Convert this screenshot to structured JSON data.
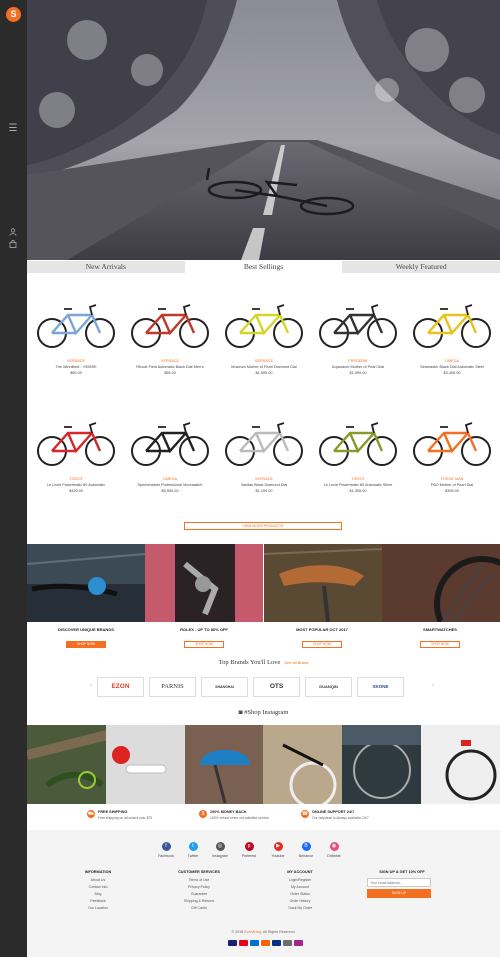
{
  "sidebar": {
    "logo": "S",
    "icons": [
      "menu-icon",
      "user-icon",
      "bag-icon"
    ]
  },
  "tabs": [
    {
      "label": "New Arrivals",
      "active": false
    },
    {
      "label": "Best Sellings",
      "active": true
    },
    {
      "label": "Weekly Featured",
      "active": false
    }
  ],
  "products": [
    {
      "brand": "VERSACE",
      "name": "The Winnifield - Y555SK",
      "price": "$95.00",
      "color": "#7aa6d8"
    },
    {
      "brand": "VERSACE",
      "name": "Rhode Field Automatic Black Dial Men's",
      "price": "$95.00",
      "color": "#c0392b"
    },
    {
      "brand": "VERSACE",
      "name": "Museum Mother of Pearl Diamond Dial",
      "price": "$1,595.00",
      "color": "#d4d62a"
    },
    {
      "brand": "FREDERIK",
      "name": "Aquaracer Mother of Pearl Dial",
      "price": "$1,399.00",
      "color": "#333333"
    },
    {
      "brand": "OMEGA",
      "name": "Seamaster Black Dial Automatic Steel",
      "price": "$3,495.00",
      "color": "#e8c31c"
    },
    {
      "brand": "TISSOT",
      "name": "Le Locle Powermatic 80 Automatic",
      "price": "$420.00",
      "color": "#d62828"
    },
    {
      "brand": "OMEGA",
      "name": "Speedmaster Professional Moonwatch",
      "price": "$5,550.00",
      "color": "#222222"
    },
    {
      "brand": "VERSACE",
      "name": "Vanitas Black Diamond Dial",
      "price": "$1,199.00",
      "color": "#bbbbbb"
    },
    {
      "brand": "TISSOT",
      "name": "Le Locle Powermatic 80 Automatic Silver",
      "price": "$1,395.00",
      "color": "#8a9a2a"
    },
    {
      "brand": "FOSSIL MAN",
      "name": "FBO Mother of Pearl Dial",
      "price": "$395.00",
      "color": "#f36f21"
    }
  ],
  "view_more": "VIEW MORE PRODUCTS",
  "categories": [
    {
      "title": "DISCOVER UNIQUE BRANDS",
      "button": "SHOP NOW",
      "filled": true
    },
    {
      "title": "ROLEX - UP TO 80% OFF",
      "button": "SHOP NOW",
      "filled": false
    },
    {
      "title": "MOST POPULAR OCT 2017",
      "button": "SHOP NOW",
      "filled": false
    },
    {
      "title": "SMARTWATCHES",
      "button": "SHOP NOW",
      "filled": false
    }
  ],
  "brands_section": {
    "title": "Top Brands You'll Love",
    "see_all": "See all Brand",
    "brands": [
      "EZON",
      "PARNIS",
      "SHANGHAI",
      "OTS",
      "GUANQIN",
      "SKONE"
    ]
  },
  "instagram_title": "#Shop Instagram",
  "features": [
    {
      "title": "FREE SHIPPING",
      "sub": "Free shipping on all orders over $75"
    },
    {
      "title": "100% MONEY BACK",
      "sub": "100% refund when not satisfied service"
    },
    {
      "title": "ONLINE SUPPORT 24/7",
      "sub": "Our helpdesk is always available 24/7"
    }
  ],
  "social": [
    {
      "label": "Facebook",
      "color": "#3b5998",
      "glyph": "f"
    },
    {
      "label": "Twitter",
      "color": "#1da1f2",
      "glyph": "t"
    },
    {
      "label": "Instagram",
      "color": "#555555",
      "glyph": "◎"
    },
    {
      "label": "Pinterest",
      "color": "#bd081c",
      "glyph": "p"
    },
    {
      "label": "Youtube",
      "color": "#e52d27",
      "glyph": "▶"
    },
    {
      "label": "Behance",
      "color": "#1769ff",
      "glyph": "B"
    },
    {
      "label": "Dribbble",
      "color": "#ea4c89",
      "glyph": "◉"
    }
  ],
  "footer_cols": [
    {
      "heading": "INFORMATION",
      "items": [
        "About Us",
        "Contact Info",
        "Blog",
        "Feedback",
        "Our Location"
      ]
    },
    {
      "heading": "CUSTOMER SERVICES",
      "items": [
        "Terms of Use",
        "Privacy Policy",
        "Guarantee",
        "Shipping & Returns",
        "Gift Cards"
      ]
    },
    {
      "heading": "MY ACCOUNT",
      "items": [
        "Login/Register",
        "My Account",
        "Order Status",
        "Order History",
        "Track My Order"
      ]
    }
  ],
  "signup": {
    "heading": "SIGN UP & GET 10% OFF",
    "placeholder": "Your email address...",
    "button": "SIGN UP"
  },
  "copyright": {
    "prefix": "© 2018 ",
    "brand": "Everything",
    "suffix": ". All Rights Reserved."
  },
  "payments": [
    "#1a1f71",
    "#eb001b",
    "#006fcf",
    "#ff6000",
    "#003087",
    "#6c6c6c",
    "#a3278f"
  ]
}
